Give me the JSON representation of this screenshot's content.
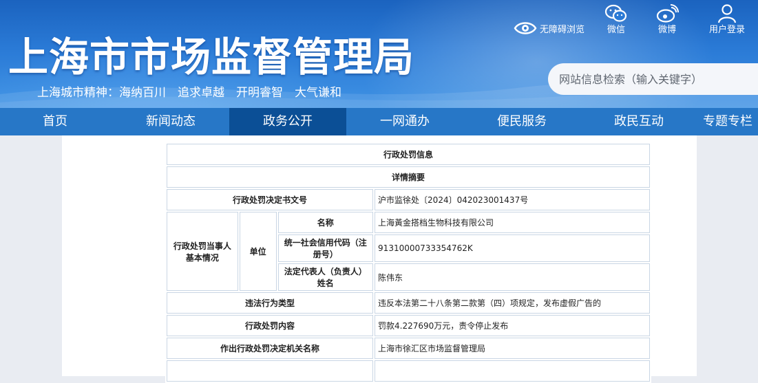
{
  "header": {
    "title": "上海市市场监督管理局",
    "slogan": "上海城市精神：海纳百川　追求卓越　开明睿智　大气谦和",
    "accessibility_label": "无障碍浏览",
    "icons": [
      {
        "label": "微信",
        "icon": "wechat-icon"
      },
      {
        "label": "微博",
        "icon": "weibo-icon"
      },
      {
        "label": "用户登录",
        "icon": "user-icon"
      }
    ],
    "search_placeholder": "网站信息检索（输入关键字）"
  },
  "nav": {
    "items": [
      "首页",
      "新闻动态",
      "政务公开",
      "一网通办",
      "便民服务",
      "政民互动",
      "专题专栏"
    ],
    "active_index": 2
  },
  "table": {
    "title": "行政处罚信息",
    "section": "详情摘要",
    "doc_no_label": "行政处罚决定书文号",
    "doc_no_value": "沪市监徐处〔2024〕042023001437号",
    "party_label": "行政处罚当事人基本情况",
    "unit_label": "单位",
    "name_label": "名称",
    "name_value": "上海黃金搭档生物科技有限公司",
    "credit_label": "统一社会信用代码（注册号）",
    "credit_value": "91310000733354762K",
    "rep_label": "法定代表人（负责人）姓名",
    "rep_value": "陈伟东",
    "violation_label": "违法行为类型",
    "violation_value": "违反本法第二十八条第二款第（四）项规定，发布虚假广告的",
    "penalty_label": "行政处罚内容",
    "penalty_value": "罚款4.227690万元，责令停止发布",
    "authority_label": "作出行政处罚决定机关名称",
    "authority_value": "上海市徐汇区市场监督管理局"
  },
  "colors": {
    "header_blue": "#2a7ad6",
    "nav_blue": "#2777c7",
    "nav_active": "#0b4f96",
    "table_border": "#c9d6e4"
  }
}
